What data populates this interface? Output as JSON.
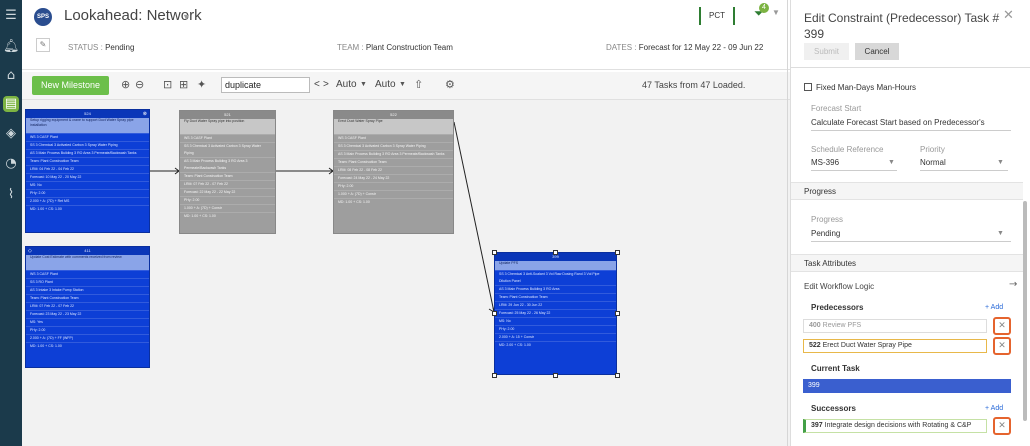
{
  "header": {
    "logo": "SPS",
    "title": "Lookahead: Network",
    "pct": "PCT",
    "filter_count": "4",
    "status_label": "STATUS :",
    "status_value": "Pending",
    "team_label": "TEAM :",
    "team_value": "Plant Construction Team",
    "dates_label": "DATES :",
    "dates_value": "Forecast for 12 May 22 - 09 Jun 22"
  },
  "toolbar": {
    "new_milestone": "New Milestone",
    "search_value": "duplicate",
    "prev": "<",
    "next": ">",
    "auto1": "Auto",
    "auto2": "Auto",
    "tasks_loaded": "47 Tasks from 47 Loaded."
  },
  "cards": [
    {
      "id": "524",
      "style": "blue",
      "desc": "Setup rigging equipment & crane to support Duct Water Spray pipe installation",
      "lines": [
        "WS 3 CASF Plant",
        "SS 3 Chemical 3 Activated Carbon 3 Spray Water Piping",
        "AS 3 Main Process Building 3 RO Area 3 Permeate/Backwash Tanks",
        "Team: Plant Construction Team",
        "LRM: 04 Feb 22 - 04 Feb 22",
        "Forecast: 10 May 22 - 20 May 22",
        "MS: No",
        "PHy: 2.00",
        "2.000 + A: (7D) + Ret MS",
        "MD: 1.00 + CS: 1.00"
      ]
    },
    {
      "id": "521",
      "style": "gray",
      "desc": "Fly Duct Water Spray pipe into position",
      "lines": [
        "WS 3 CASF Plant",
        "SS 3 Chemical 3 Activated Carbon 3 Spray Water Piping",
        "AS 3 Main Process Building 3 RO Area 3 Permeate/Backwash Tanks",
        "Team: Plant Construction Team",
        "LRM: 07 Feb 22 - 07 Feb 22",
        "Forecast: 22 May 22 - 22 May 22",
        "PHy: 2.00",
        "1.000 + A: (7D) + Constr",
        "MD: 1.00 + CS: 1.00"
      ]
    },
    {
      "id": "522",
      "style": "gray",
      "desc": "Erect Duct Water Spray Pipe",
      "lines": [
        "WS 3 CASF Plant",
        "SS 3 Chemical 3 Activated Carbon 3 Spray Water Piping",
        "AS 3 Main Process Building 3 RO Area 3 Permeate/Backwash Tanks",
        "Team: Plant Construction Team",
        "LRM: 08 Feb 22 - 08 Feb 22",
        "Forecast: 24 May 22 - 24 May 22",
        "PHy: 2.00",
        "1.000 + A: (7D) + Constr",
        "MD: 1.00 + CS: 1.00"
      ]
    },
    {
      "id": "411",
      "style": "blue",
      "desc": "Update Cost Estimate with comments received from review",
      "lines": [
        "WS 3 CASF Plant",
        "SS 3 RO Plant",
        "AS 3 Intake 3 Intake Pump Station",
        "Team: Plant Construction Team",
        "LRM: 07 Feb 22 - 07 Feb 22",
        "Forecast: 23 May 22 - 23 May 22",
        "MS: Yes",
        "PHy: 2.00",
        "2.000 + A: (7D) + FF (WFP)",
        "MD: 1.00 + CS: 1.00"
      ]
    },
    {
      "id": "399",
      "style": "blue",
      "desc": "Update PFS",
      "lines": [
        "SS 3 Chemical 3 Anti-Scalant 3 Vol Raw Dosing Rand 3 Vol Pipe Dilution Panel",
        "AS 3 Main Process Building 3 RO Area",
        "Team: Plant Construction Team",
        "LRM: 29 Jun 22 - 30 Jun 22",
        "Forecast: 25 May 22 - 26 May 22",
        "MS: No",
        "PHy: 2.00",
        "2.000 + A: 15 + Constr",
        "MD: 2.00 + CS: 1.00"
      ]
    }
  ],
  "panel": {
    "title": "Edit Constraint (Predecessor) Task # 399",
    "submit": "Submit",
    "cancel": "Cancel",
    "fixed_label": "Fixed Man-Days Man-Hours",
    "forecast_start_label": "Forecast Start",
    "forecast_start_value": "Calculate Forecast Start based on Predecessor's",
    "schedule_ref_label": "Schedule Reference",
    "schedule_ref_value": "MS-396",
    "priority_label": "Priority",
    "priority_value": "Normal",
    "progress_section": "Progress",
    "progress_label": "Progress",
    "progress_value": "Pending",
    "task_attributes": "Task Attributes",
    "workflow": "Edit Workflow Logic",
    "predecessors_label": "Predecessors",
    "add": "+ Add",
    "pred1_id": "400",
    "pred1_name": "Review PFS",
    "pred2_id": "522",
    "pred2_name": "Erect Duct Water Spray Pipe",
    "current_label": "Current Task",
    "current_value": "399",
    "successors_label": "Successors",
    "succ1_id": "397",
    "succ1_name": "Integrate design decisions with Rotating & C&P"
  },
  "colors": {
    "rail": "#1b3a4b",
    "accent_green": "#6cbf4a",
    "task_blue": "#0d3fd6",
    "task_gray": "#9e9e9e",
    "highlight": "#e5642e"
  }
}
